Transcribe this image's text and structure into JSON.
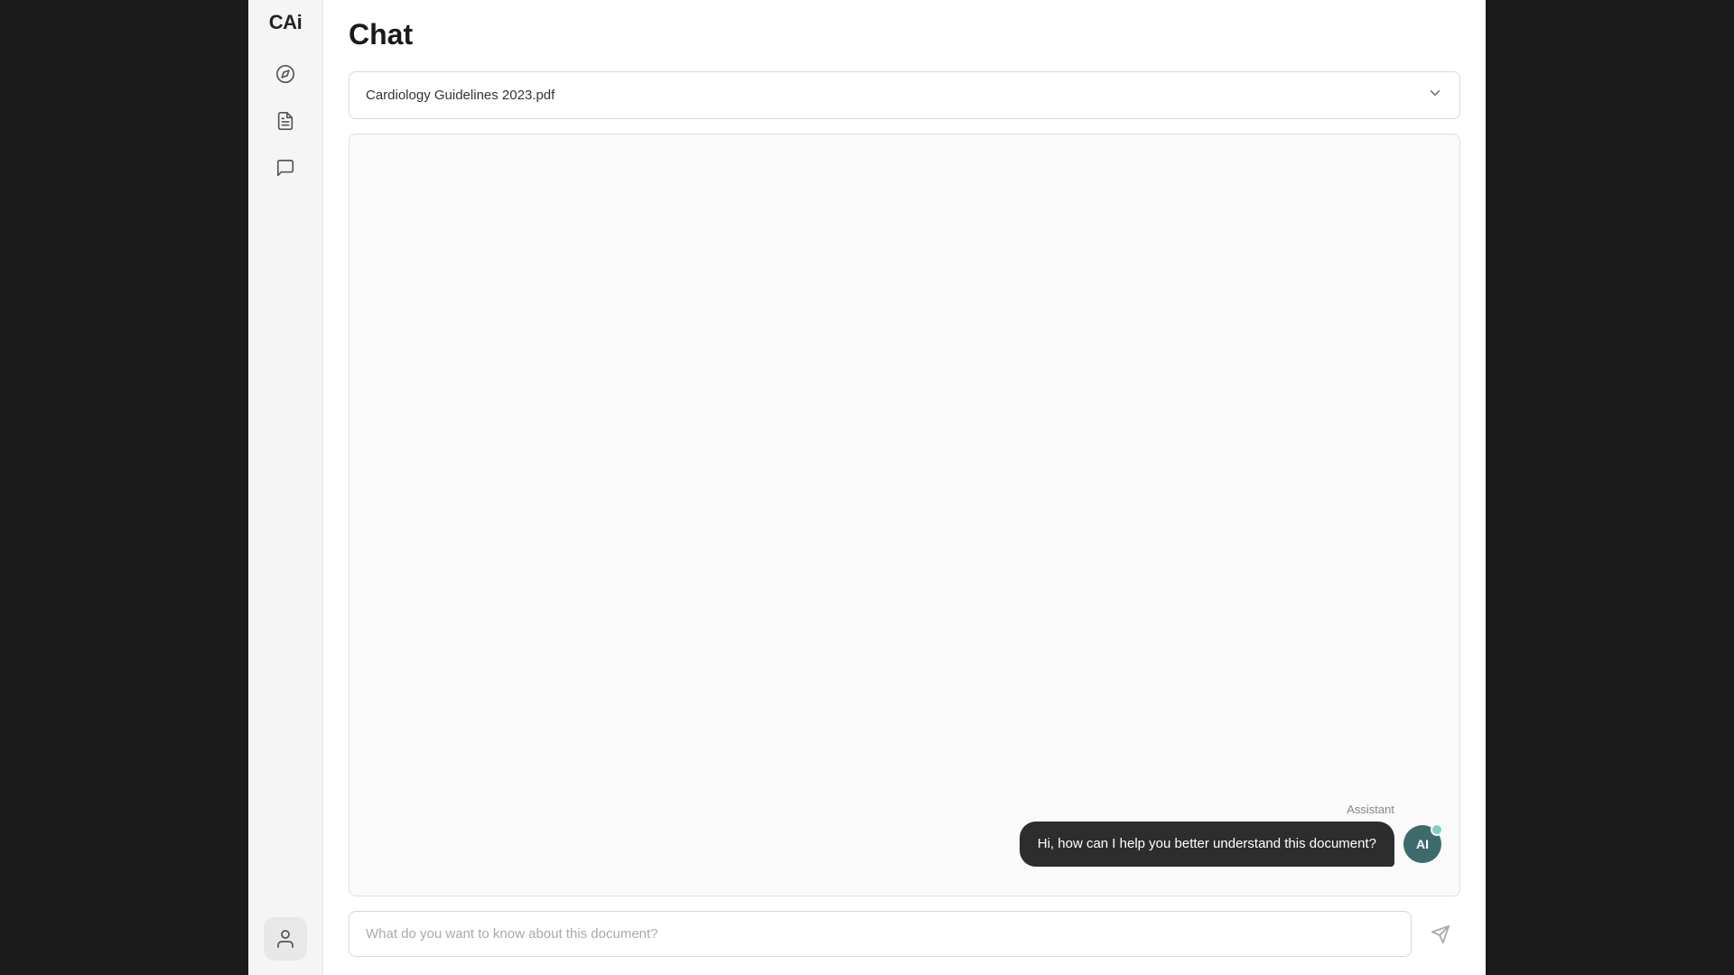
{
  "app": {
    "logo": "CAi"
  },
  "sidebar": {
    "nav_items": [
      {
        "id": "compass",
        "label": "compass-icon"
      },
      {
        "id": "document",
        "label": "document-icon"
      },
      {
        "id": "chat",
        "label": "chat-icon"
      }
    ]
  },
  "page": {
    "title": "Chat"
  },
  "document_selector": {
    "selected": "Cardiology Guidelines 2023.pdf",
    "chevron_label": "chevron-down"
  },
  "chat": {
    "messages": [
      {
        "role": "assistant",
        "role_label": "Assistant",
        "text": "Hi, how can I help you better understand this document?",
        "avatar_initials": "AI"
      }
    ],
    "input_placeholder": "What do you want to know about this document?"
  },
  "bottom_nav": {
    "user_icon_label": "user-icon"
  }
}
